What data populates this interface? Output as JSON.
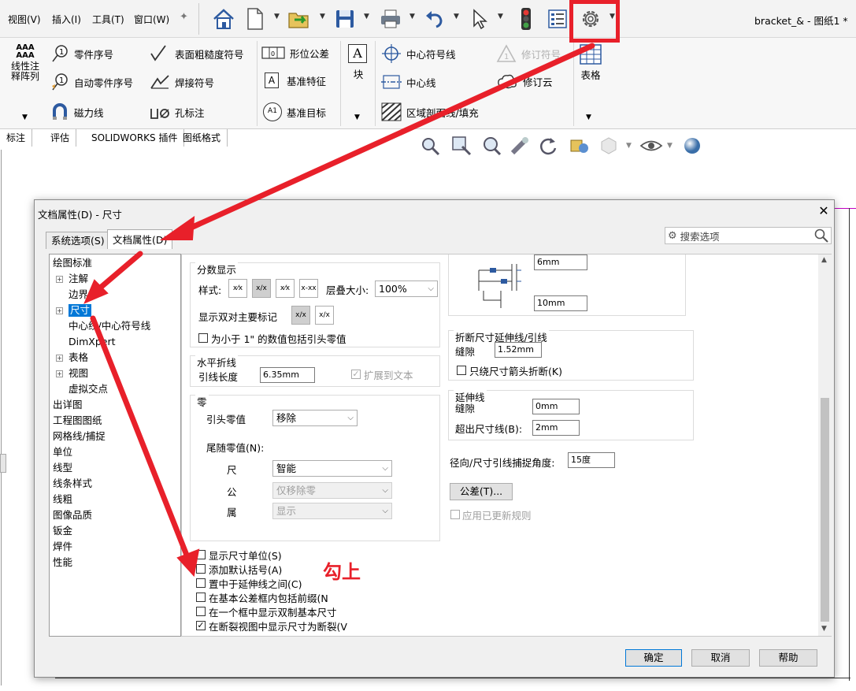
{
  "menu": {
    "view": "视图(V)",
    "insert": "插入(I)",
    "tools": "工具(T)",
    "window": "窗口(W)"
  },
  "window_title": "bracket_& - 图纸1 *",
  "ribbon": {
    "linear_pattern": "线性注\n释阵列",
    "linear_pattern_icon_text": "AAA\nAAA",
    "balloon": "零件序号",
    "surface_finish": "表面粗糙度符号",
    "gtol": "形位公差",
    "block": "块",
    "center_mark": "中心符号线",
    "revision_symbol": "修订符号",
    "table": "表格",
    "auto_balloon": "自动零件序号",
    "weld_symbol": "焊接符号",
    "datum_feature": "基准特征",
    "datum_feature_icon": "A",
    "centerline": "中心线",
    "revision_cloud": "修订云",
    "magnetic_line": "磁力线",
    "hole_callout": "孔标注",
    "datum_target": "基准目标",
    "datum_target_icon": "A1",
    "area_hatch": "区域剖面线/填充",
    "block_icon": "A"
  },
  "cmd_tabs": [
    "标注",
    "评估",
    "SOLIDWORKS 插件",
    "图纸格式"
  ],
  "dialog": {
    "title": "文档属性(D) - 尺寸",
    "close": "✕",
    "tab_system": "系统选项(S)",
    "tab_document": "文档属性(D)",
    "search_placeholder": "搜索选项",
    "tree": [
      {
        "label": "绘图标准",
        "indent": 0,
        "exp": ""
      },
      {
        "label": "注解",
        "indent": 1,
        "exp": "+"
      },
      {
        "label": "边界",
        "indent": 1,
        "exp": ""
      },
      {
        "label": "尺寸",
        "indent": 1,
        "exp": "+",
        "selected": true
      },
      {
        "label": "中心线/中心符号线",
        "indent": 1,
        "exp": ""
      },
      {
        "label": "DimXpert",
        "indent": 1,
        "exp": ""
      },
      {
        "label": "表格",
        "indent": 1,
        "exp": "+"
      },
      {
        "label": "视图",
        "indent": 1,
        "exp": "+"
      },
      {
        "label": "虚拟交点",
        "indent": 1,
        "exp": ""
      },
      {
        "label": "出详图",
        "indent": 0,
        "exp": ""
      },
      {
        "label": "工程图图纸",
        "indent": 0,
        "exp": ""
      },
      {
        "label": "网格线/捕捉",
        "indent": 0,
        "exp": ""
      },
      {
        "label": "单位",
        "indent": 0,
        "exp": ""
      },
      {
        "label": "线型",
        "indent": 0,
        "exp": ""
      },
      {
        "label": "线条样式",
        "indent": 0,
        "exp": ""
      },
      {
        "label": "线粗",
        "indent": 0,
        "exp": ""
      },
      {
        "label": "图像品质",
        "indent": 0,
        "exp": ""
      },
      {
        "label": "钣金",
        "indent": 0,
        "exp": ""
      },
      {
        "label": "焊件",
        "indent": 0,
        "exp": ""
      },
      {
        "label": "性能",
        "indent": 0,
        "exp": ""
      }
    ],
    "fraction": {
      "title": "分数显示",
      "style_label": "样式:",
      "style_btns": [
        "x⁄x",
        "x/x",
        "x⁄x",
        "x-xx"
      ],
      "stack_label": "层叠大小:",
      "stack_value": "100%",
      "dual_label": "显示双对主要标记",
      "dual_btns": [
        "x/x",
        "x/x"
      ],
      "leading_zero_label": "为小于 1\" 的数值包括引头零值"
    },
    "bent_leader": {
      "title": "水平折线",
      "leader_len_label": "引线长度",
      "leader_len_value": "6.35mm",
      "extend_label": "扩展到文本"
    },
    "zeros": {
      "title": "零",
      "leading_label": "引头零值",
      "leading_value": "移除",
      "trailing_label": "尾随零值(N):",
      "dim_label": "尺",
      "dim_value": "智能",
      "tol_label": "公",
      "tol_value": "仅移除零",
      "prop_label": "属",
      "prop_value": "显示"
    },
    "checkboxes": [
      {
        "label": "显示尺寸单位(S)",
        "checked": false
      },
      {
        "label": "添加默认括号(A)",
        "checked": false
      },
      {
        "label": "置中于延伸线之间(C)",
        "checked": false
      },
      {
        "label": "在基本公差框内包括前缀(N",
        "checked": false
      },
      {
        "label": "在一个框中显示双制基本尺寸",
        "checked": false
      },
      {
        "label": "在断裂视图中显示尺寸为断裂(V",
        "checked": true
      }
    ],
    "right": {
      "offset1": "6mm",
      "offset2": "10mm",
      "break_title": "折断尺寸延伸线/引线",
      "gap_label": "缝隙",
      "gap_value": "1.52mm",
      "arrow_only_label": "只绕尺寸箭头折断(K)",
      "ext_title": "延伸线",
      "ext_gap_label": "缝隙",
      "ext_gap_value": "0mm",
      "beyond_label": "超出尺寸线(B):",
      "beyond_value": "2mm",
      "snap_label": "径向/尺寸引线捕捉角度:",
      "snap_value": "15度",
      "tolerance_btn": "公差(T)...",
      "apply_rules_label": "应用已更新规则"
    },
    "ok": "确定",
    "cancel": "取消",
    "help": "帮助"
  },
  "annotation": {
    "text": "勾上",
    "color": "#e8202a"
  },
  "colors": {
    "selection": "#0078d7",
    "annotation": "#e8202a"
  }
}
